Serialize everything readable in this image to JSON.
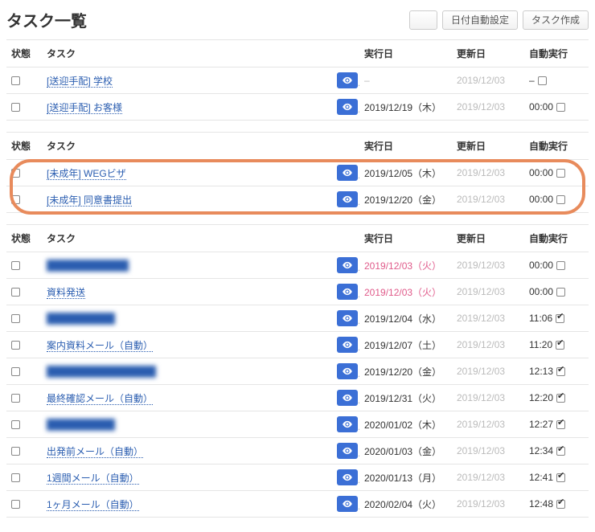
{
  "header": {
    "title": "タスク一覧",
    "btn_blurred": "    ",
    "btn_auto_date": "日付自動設定",
    "btn_create": "タスク作成"
  },
  "columns": {
    "status": "状態",
    "task": "タスク",
    "exec": "実行日",
    "updated": "更新日",
    "auto": "自動実行"
  },
  "groups": [
    {
      "rows": [
        {
          "task": "[送迎手配] 学校",
          "blurred": false,
          "exec": "–",
          "exec_hl": false,
          "updated": "2019/12/03",
          "auto_time": "–",
          "auto_checked": false
        },
        {
          "task": "[送迎手配] お客様",
          "blurred": false,
          "exec": "2019/12/19（木）",
          "exec_hl": false,
          "updated": "2019/12/03",
          "auto_time": "00:00",
          "auto_checked": false
        }
      ]
    },
    {
      "highlighted": true,
      "rows": [
        {
          "task": "[未成年] WEGビザ",
          "blurred": false,
          "exec": "2019/12/05（木）",
          "exec_hl": false,
          "updated": "2019/12/03",
          "auto_time": "00:00",
          "auto_checked": false
        },
        {
          "task": "[未成年] 同意書提出",
          "blurred": false,
          "exec": "2019/12/20（金）",
          "exec_hl": false,
          "updated": "2019/12/03",
          "auto_time": "00:00",
          "auto_checked": false
        }
      ]
    },
    {
      "rows": [
        {
          "task": "████████████",
          "blurred": true,
          "exec": "2019/12/03（火）",
          "exec_hl": true,
          "updated": "2019/12/03",
          "auto_time": "00:00",
          "auto_checked": false
        },
        {
          "task": "資料発送",
          "blurred": false,
          "exec": "2019/12/03（火）",
          "exec_hl": true,
          "updated": "2019/12/03",
          "auto_time": "00:00",
          "auto_checked": false
        },
        {
          "task": "██████████",
          "blurred": true,
          "exec": "2019/12/04（水）",
          "exec_hl": false,
          "updated": "2019/12/03",
          "auto_time": "11:06",
          "auto_checked": true
        },
        {
          "task": "案内資料メール（自動）",
          "blurred": false,
          "exec": "2019/12/07（土）",
          "exec_hl": false,
          "updated": "2019/12/03",
          "auto_time": "11:20",
          "auto_checked": true
        },
        {
          "task": "████████████████",
          "blurred": true,
          "exec": "2019/12/20（金）",
          "exec_hl": false,
          "updated": "2019/12/03",
          "auto_time": "12:13",
          "auto_checked": true
        },
        {
          "task": "最終確認メール（自動）",
          "blurred": false,
          "exec": "2019/12/31（火）",
          "exec_hl": false,
          "updated": "2019/12/03",
          "auto_time": "12:20",
          "auto_checked": true
        },
        {
          "task": "██████████",
          "blurred": true,
          "exec": "2020/01/02（木）",
          "exec_hl": false,
          "updated": "2019/12/03",
          "auto_time": "12:27",
          "auto_checked": true
        },
        {
          "task": "出発前メール（自動）",
          "blurred": false,
          "exec": "2020/01/03（金）",
          "exec_hl": false,
          "updated": "2019/12/03",
          "auto_time": "12:34",
          "auto_checked": true
        },
        {
          "task": "1週間メール（自動）",
          "blurred": false,
          "exec": "2020/01/13（月）",
          "exec_hl": false,
          "updated": "2019/12/03",
          "auto_time": "12:41",
          "auto_checked": true
        },
        {
          "task": "1ヶ月メール（自動）",
          "blurred": false,
          "exec": "2020/02/04（火）",
          "exec_hl": false,
          "updated": "2019/12/03",
          "auto_time": "12:48",
          "auto_checked": true
        }
      ]
    }
  ]
}
